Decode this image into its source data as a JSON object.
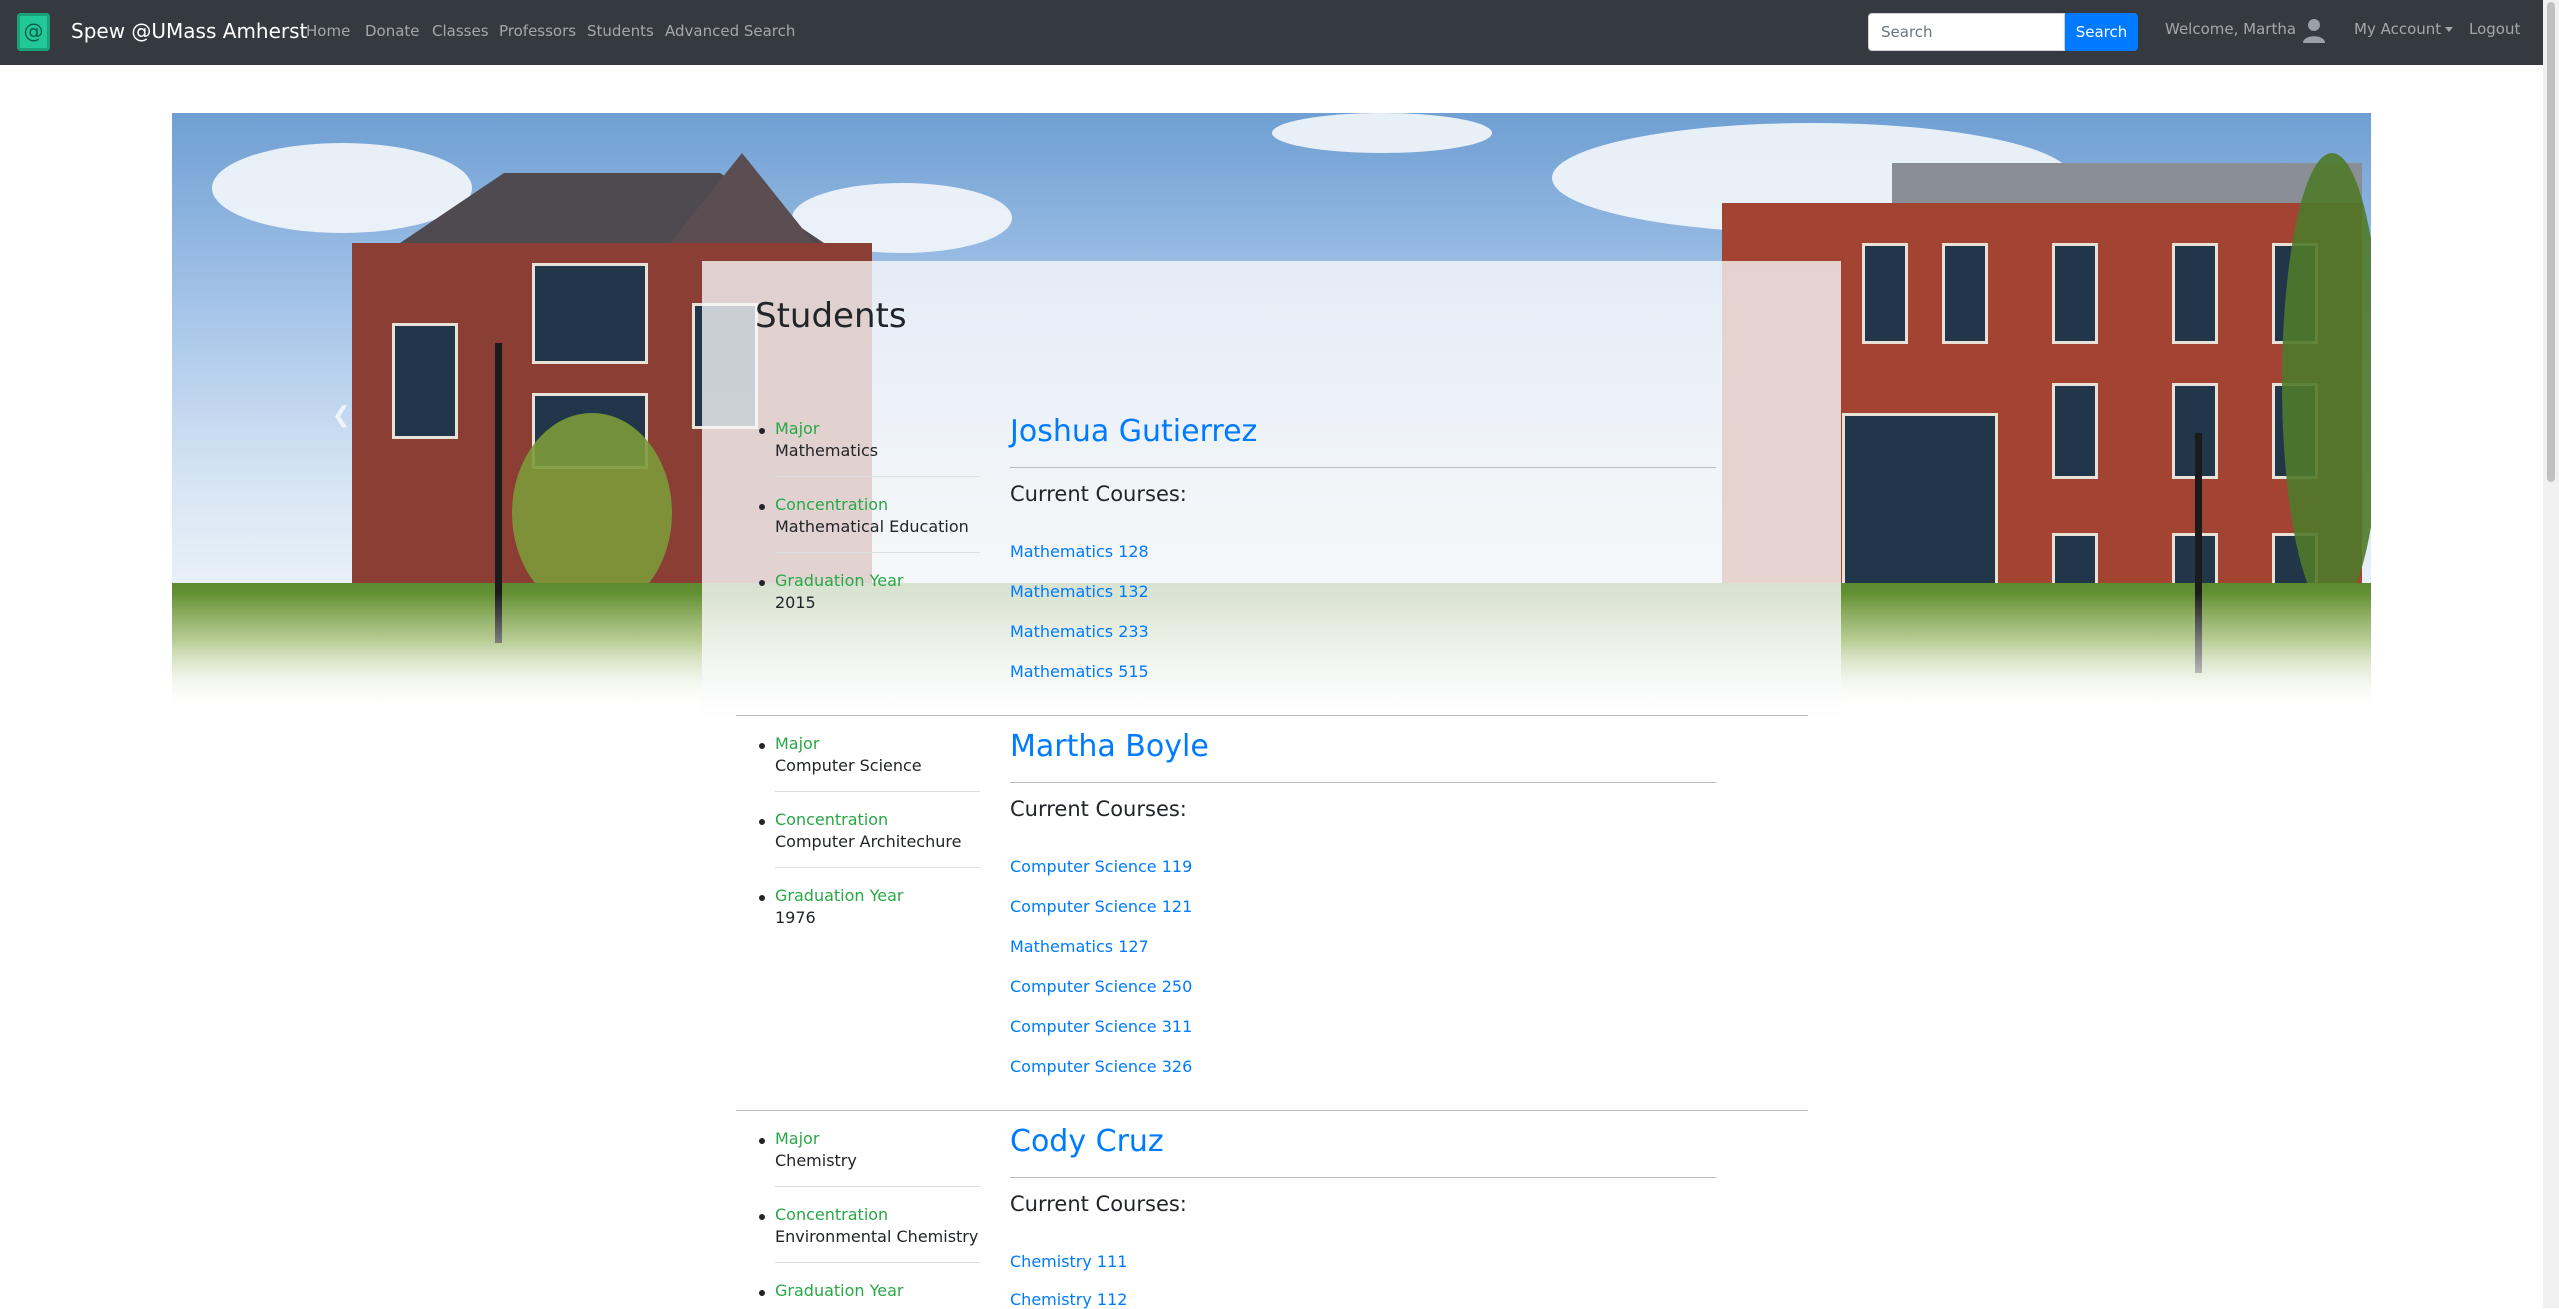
{
  "navbar": {
    "brand": "Spew @UMass Amherst",
    "links": [
      "Home",
      "Donate",
      "Classes",
      "Professors",
      "Students",
      "Advanced Search"
    ],
    "search_placeholder": "Search",
    "search_button": "Search",
    "welcome": "Welcome, Martha",
    "account": "My Account",
    "logout": "Logout"
  },
  "page": {
    "title": "Students"
  },
  "labels": {
    "major": "Major",
    "concentration": "Concentration",
    "graduation_year": "Graduation Year",
    "current_courses": "Current Courses:"
  },
  "students": [
    {
      "name": "Joshua Gutierrez",
      "major": "Mathematics",
      "concentration": "Mathematical Education",
      "graduation_year": "2015",
      "courses": [
        "Mathematics 128",
        "Mathematics 132",
        "Mathematics 233",
        "Mathematics 515"
      ]
    },
    {
      "name": "Martha Boyle",
      "major": "Computer Science",
      "concentration": "Computer Architechure",
      "graduation_year": "1976",
      "courses": [
        "Computer Science 119",
        "Computer Science 121",
        "Mathematics 127",
        "Computer Science 250",
        "Computer Science 311",
        "Computer Science 326"
      ]
    },
    {
      "name": "Cody Cruz",
      "major": "Chemistry",
      "concentration": "Environmental Chemistry",
      "graduation_year": "",
      "courses": [
        "Chemistry 111",
        "Chemistry 112"
      ]
    }
  ],
  "colors": {
    "navbar_bg": "#343a40",
    "accent_blue": "#007bff",
    "label_green": "#28a745"
  }
}
